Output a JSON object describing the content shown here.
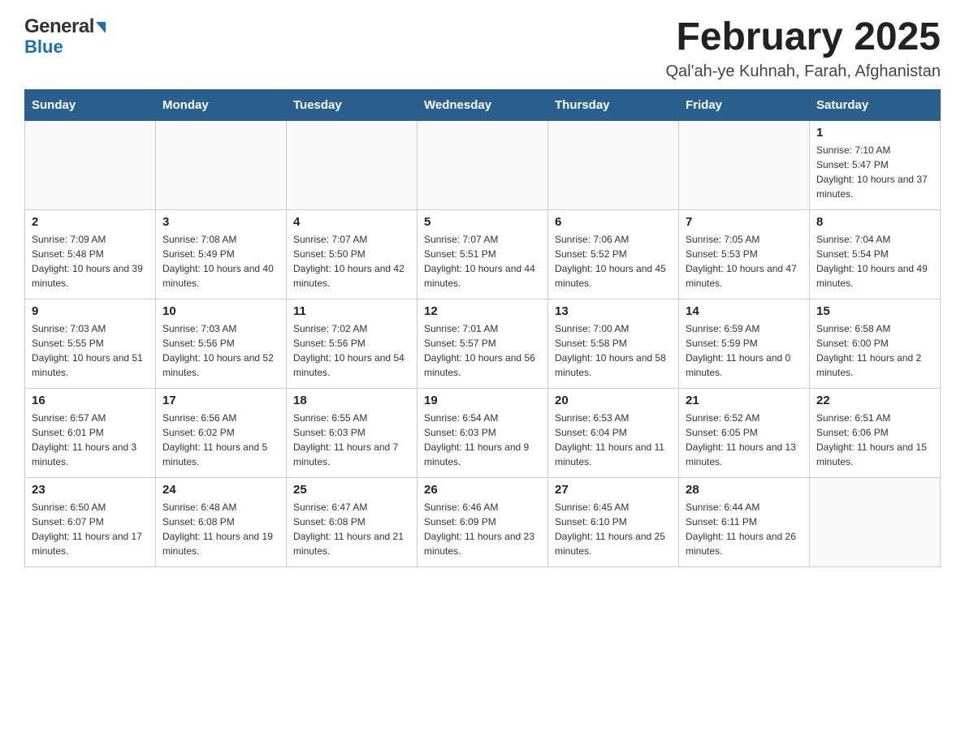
{
  "header": {
    "logo_general": "General",
    "logo_blue": "Blue",
    "title": "February 2025",
    "subtitle": "Qal'ah-ye Kuhnah, Farah, Afghanistan"
  },
  "weekdays": [
    "Sunday",
    "Monday",
    "Tuesday",
    "Wednesday",
    "Thursday",
    "Friday",
    "Saturday"
  ],
  "weeks": [
    [
      {
        "day": "",
        "info": ""
      },
      {
        "day": "",
        "info": ""
      },
      {
        "day": "",
        "info": ""
      },
      {
        "day": "",
        "info": ""
      },
      {
        "day": "",
        "info": ""
      },
      {
        "day": "",
        "info": ""
      },
      {
        "day": "1",
        "info": "Sunrise: 7:10 AM\nSunset: 5:47 PM\nDaylight: 10 hours and 37 minutes."
      }
    ],
    [
      {
        "day": "2",
        "info": "Sunrise: 7:09 AM\nSunset: 5:48 PM\nDaylight: 10 hours and 39 minutes."
      },
      {
        "day": "3",
        "info": "Sunrise: 7:08 AM\nSunset: 5:49 PM\nDaylight: 10 hours and 40 minutes."
      },
      {
        "day": "4",
        "info": "Sunrise: 7:07 AM\nSunset: 5:50 PM\nDaylight: 10 hours and 42 minutes."
      },
      {
        "day": "5",
        "info": "Sunrise: 7:07 AM\nSunset: 5:51 PM\nDaylight: 10 hours and 44 minutes."
      },
      {
        "day": "6",
        "info": "Sunrise: 7:06 AM\nSunset: 5:52 PM\nDaylight: 10 hours and 45 minutes."
      },
      {
        "day": "7",
        "info": "Sunrise: 7:05 AM\nSunset: 5:53 PM\nDaylight: 10 hours and 47 minutes."
      },
      {
        "day": "8",
        "info": "Sunrise: 7:04 AM\nSunset: 5:54 PM\nDaylight: 10 hours and 49 minutes."
      }
    ],
    [
      {
        "day": "9",
        "info": "Sunrise: 7:03 AM\nSunset: 5:55 PM\nDaylight: 10 hours and 51 minutes."
      },
      {
        "day": "10",
        "info": "Sunrise: 7:03 AM\nSunset: 5:56 PM\nDaylight: 10 hours and 52 minutes."
      },
      {
        "day": "11",
        "info": "Sunrise: 7:02 AM\nSunset: 5:56 PM\nDaylight: 10 hours and 54 minutes."
      },
      {
        "day": "12",
        "info": "Sunrise: 7:01 AM\nSunset: 5:57 PM\nDaylight: 10 hours and 56 minutes."
      },
      {
        "day": "13",
        "info": "Sunrise: 7:00 AM\nSunset: 5:58 PM\nDaylight: 10 hours and 58 minutes."
      },
      {
        "day": "14",
        "info": "Sunrise: 6:59 AM\nSunset: 5:59 PM\nDaylight: 11 hours and 0 minutes."
      },
      {
        "day": "15",
        "info": "Sunrise: 6:58 AM\nSunset: 6:00 PM\nDaylight: 11 hours and 2 minutes."
      }
    ],
    [
      {
        "day": "16",
        "info": "Sunrise: 6:57 AM\nSunset: 6:01 PM\nDaylight: 11 hours and 3 minutes."
      },
      {
        "day": "17",
        "info": "Sunrise: 6:56 AM\nSunset: 6:02 PM\nDaylight: 11 hours and 5 minutes."
      },
      {
        "day": "18",
        "info": "Sunrise: 6:55 AM\nSunset: 6:03 PM\nDaylight: 11 hours and 7 minutes."
      },
      {
        "day": "19",
        "info": "Sunrise: 6:54 AM\nSunset: 6:03 PM\nDaylight: 11 hours and 9 minutes."
      },
      {
        "day": "20",
        "info": "Sunrise: 6:53 AM\nSunset: 6:04 PM\nDaylight: 11 hours and 11 minutes."
      },
      {
        "day": "21",
        "info": "Sunrise: 6:52 AM\nSunset: 6:05 PM\nDaylight: 11 hours and 13 minutes."
      },
      {
        "day": "22",
        "info": "Sunrise: 6:51 AM\nSunset: 6:06 PM\nDaylight: 11 hours and 15 minutes."
      }
    ],
    [
      {
        "day": "23",
        "info": "Sunrise: 6:50 AM\nSunset: 6:07 PM\nDaylight: 11 hours and 17 minutes."
      },
      {
        "day": "24",
        "info": "Sunrise: 6:48 AM\nSunset: 6:08 PM\nDaylight: 11 hours and 19 minutes."
      },
      {
        "day": "25",
        "info": "Sunrise: 6:47 AM\nSunset: 6:08 PM\nDaylight: 11 hours and 21 minutes."
      },
      {
        "day": "26",
        "info": "Sunrise: 6:46 AM\nSunset: 6:09 PM\nDaylight: 11 hours and 23 minutes."
      },
      {
        "day": "27",
        "info": "Sunrise: 6:45 AM\nSunset: 6:10 PM\nDaylight: 11 hours and 25 minutes."
      },
      {
        "day": "28",
        "info": "Sunrise: 6:44 AM\nSunset: 6:11 PM\nDaylight: 11 hours and 26 minutes."
      },
      {
        "day": "",
        "info": ""
      }
    ]
  ]
}
